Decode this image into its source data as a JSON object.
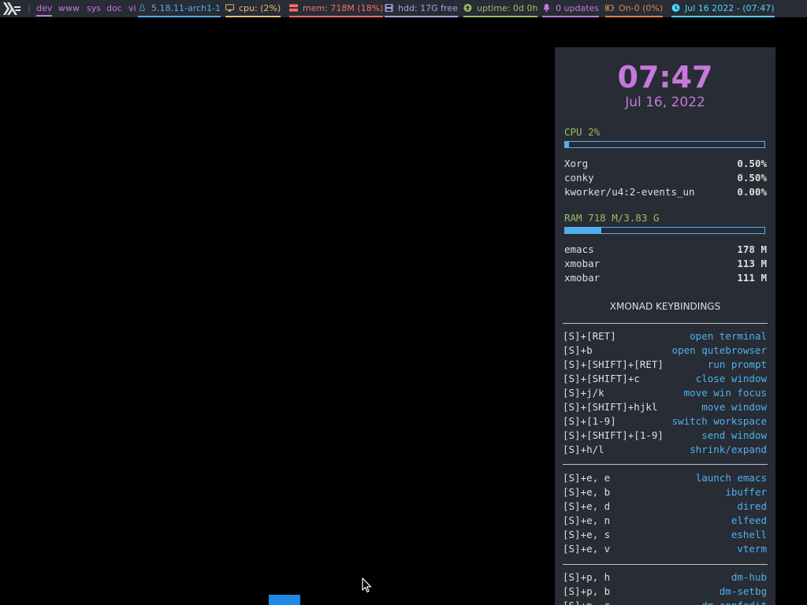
{
  "topbar": {
    "workspaces": [
      "dev",
      "www",
      "sys",
      "doc",
      "vi"
    ],
    "active_workspace": "dev",
    "kernel": "5.18.11-arch1-1",
    "cpu": "cpu: (2%)",
    "mem": "mem: 718M (18%)",
    "hdd": "hdd: 17G free",
    "uptime": "uptime: 0d 0h",
    "updates": "0 updates",
    "battery": "On-0 (0%)",
    "datetime": "Jul 16 2022 - (07:47)",
    "colors": {
      "background": "#282c34",
      "kernel": "#51afef",
      "cpu": "#ecbe7b",
      "mem": "#ff6c6b",
      "hdd": "#a9a1e1",
      "uptime": "#98be65",
      "updates": "#c678dd",
      "battery": "#da8548",
      "datetime": "#46d9ff"
    }
  },
  "conky": {
    "time": "07:47",
    "date": "Jul 16, 2022",
    "cpu_label": "CPU  2%",
    "cpu_percent": 2,
    "cpu_processes": [
      {
        "name": "Xorg",
        "value": "0.50%"
      },
      {
        "name": "conky",
        "value": "0.50%"
      },
      {
        "name": "kworker/u4:2-events_un",
        "value": "0.00%"
      }
    ],
    "ram_label": "RAM  718 M/3.83 G",
    "ram_fraction": 0.18,
    "mem_processes": [
      {
        "name": "emacs",
        "value": "178 M"
      },
      {
        "name": "xmobar",
        "value": "113 M"
      },
      {
        "name": "xmobar",
        "value": "111 M"
      }
    ],
    "keybindings_title": "XMONAD KEYBINDINGS",
    "keybindings_group1": [
      {
        "key": "[S]+[RET]",
        "action": "open terminal"
      },
      {
        "key": "[S]+b",
        "action": "open qutebrowser"
      },
      {
        "key": "[S]+[SHIFT]+[RET]",
        "action": "run prompt"
      },
      {
        "key": "[S]+[SHIFT]+c",
        "action": "close window"
      },
      {
        "key": "[S]+j/k",
        "action": "move win focus"
      },
      {
        "key": "[S]+[SHIFT]+hjkl",
        "action": "move window"
      },
      {
        "key": "[S]+[1-9]",
        "action": "switch workspace"
      },
      {
        "key": "[S]+[SHIFT]+[1-9]",
        "action": "send window"
      },
      {
        "key": "[S]+h/l",
        "action": "shrink/expand"
      }
    ],
    "keybindings_group2": [
      {
        "key": "[S]+e, e",
        "action": "launch emacs"
      },
      {
        "key": "[S]+e, b",
        "action": "ibuffer"
      },
      {
        "key": "[S]+e, d",
        "action": "dired"
      },
      {
        "key": "[S]+e, n",
        "action": "elfeed"
      },
      {
        "key": "[S]+e, s",
        "action": "eshell"
      },
      {
        "key": "[S]+e, v",
        "action": "vterm"
      }
    ],
    "keybindings_group3": [
      {
        "key": "[S]+p, h",
        "action": "dm-hub"
      },
      {
        "key": "[S]+p, b",
        "action": "dm-setbg"
      },
      {
        "key": "[S]+p, c",
        "action": "dm-confedit"
      }
    ]
  }
}
